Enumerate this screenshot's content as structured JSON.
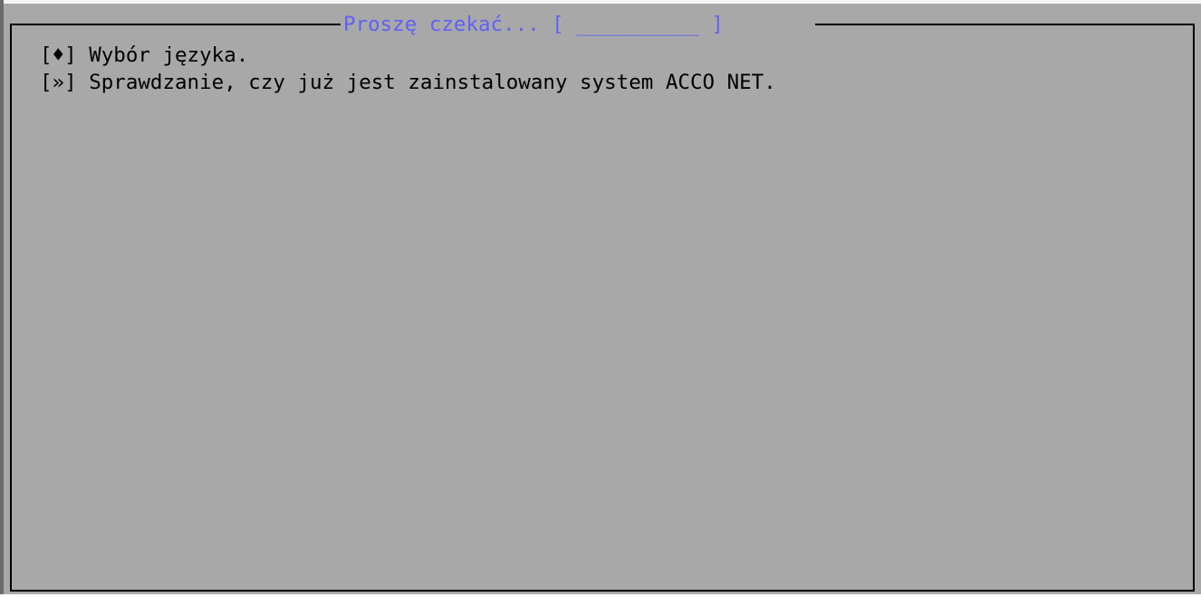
{
  "dialog": {
    "title": "Proszę czekać...",
    "progress": {
      "open_bracket": "[",
      "bar": " __________ ",
      "close_bracket": "]"
    }
  },
  "steps": [
    {
      "marker": "[♦]",
      "text": "Wybór języka."
    },
    {
      "marker": "[»]",
      "text": "Sprawdzanie, czy już jest zainstalowany system ACCO NET."
    }
  ],
  "colors": {
    "background": "#a8a8a8",
    "title": "#6060f8",
    "text": "#000000",
    "frame": "#000000"
  }
}
